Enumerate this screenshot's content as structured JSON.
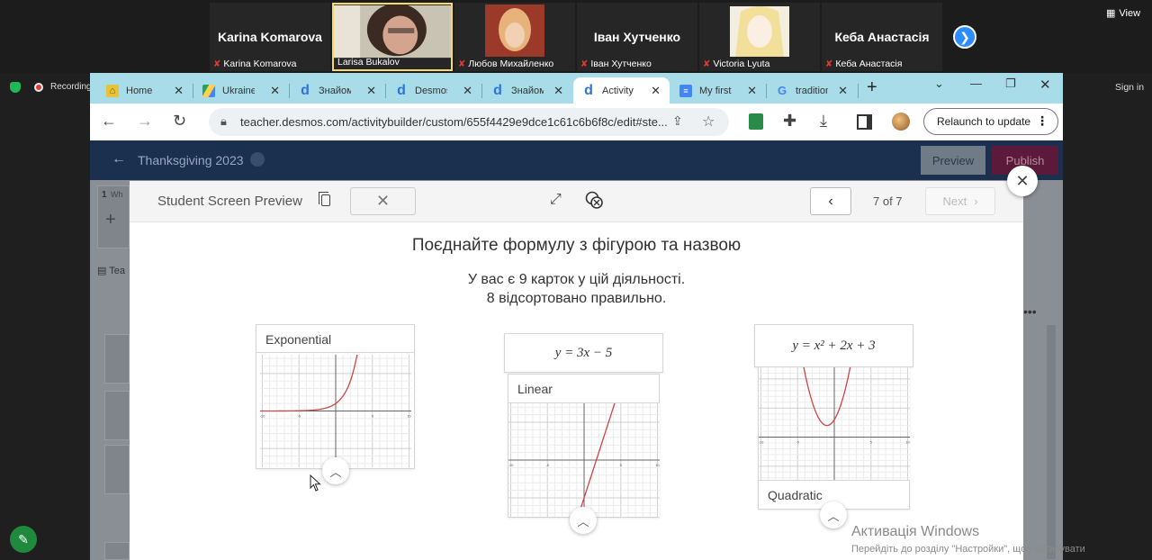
{
  "meeting": {
    "participants": [
      {
        "big_name": "Karina Komarova",
        "label": "Karina Komarova",
        "muted": true
      },
      {
        "big_name": "",
        "label": "Larisa Bukalov",
        "muted": false
      },
      {
        "big_name": "",
        "label": "Любов Михайленко",
        "muted": true
      },
      {
        "big_name": "Іван Хутченко",
        "label": "Іван Хутченко",
        "muted": true
      },
      {
        "big_name": "",
        "label": "Victoria Lyuta",
        "muted": true
      },
      {
        "big_name": "Кеба Анастасія",
        "label": "Кеба Анастасія",
        "muted": true
      }
    ],
    "view_label": "View",
    "recording_label": "Recording",
    "sign_in_label": "Sign in"
  },
  "browser": {
    "tabs": [
      {
        "label": "Home",
        "icon": "home-icon"
      },
      {
        "label": "Ukraine",
        "icon": "drive-icon"
      },
      {
        "label": "Знайом",
        "icon": "desmos-icon"
      },
      {
        "label": "Desmos",
        "icon": "desmos-icon"
      },
      {
        "label": "Знайом",
        "icon": "desmos-icon"
      },
      {
        "label": "Activity",
        "icon": "desmos-icon",
        "active": true
      },
      {
        "label": "My first",
        "icon": "docs-icon"
      },
      {
        "label": "tradition",
        "icon": "google-icon"
      }
    ],
    "url": "teacher.desmos.com/activitybuilder/custom/655f4429e9dce1c61c6b6f8c/edit#ste...",
    "relaunch_label": "Relaunch to update"
  },
  "desmos": {
    "activity_title": "Thanksgiving 2023",
    "preview_label": "Preview",
    "publish_label": "Publish",
    "side_item_1": "1",
    "side_item_1_text": "Wh",
    "teacher_tab": "Tea"
  },
  "modal": {
    "header_title": "Student Screen Preview",
    "page_indicator": "7 of 7",
    "next_label": "Next",
    "screen_title": "Поєднайте формулу з фігурою та назвою",
    "status_line1": "У вас є 9 карток у цій діяльності.",
    "status_line2": "8 відсортовано правильно.",
    "groups": [
      {
        "top_label": "Exponential",
        "formula": "",
        "bottom_label": ""
      },
      {
        "top_label": "",
        "formula": "y = 3x − 5",
        "bottom_label": "Linear"
      },
      {
        "top_label": "",
        "formula": "y = x² + 2x + 3",
        "bottom_label": "Quadratic"
      }
    ],
    "graph_ticks": {
      "neg": "-10",
      "neg_half": "-5",
      "pos_half": "5",
      "pos": "10"
    }
  },
  "windows_watermark": {
    "line1": "Активація Windows",
    "line2": "Перейдіть до розділу \"Настройки\", щоб активувати"
  }
}
